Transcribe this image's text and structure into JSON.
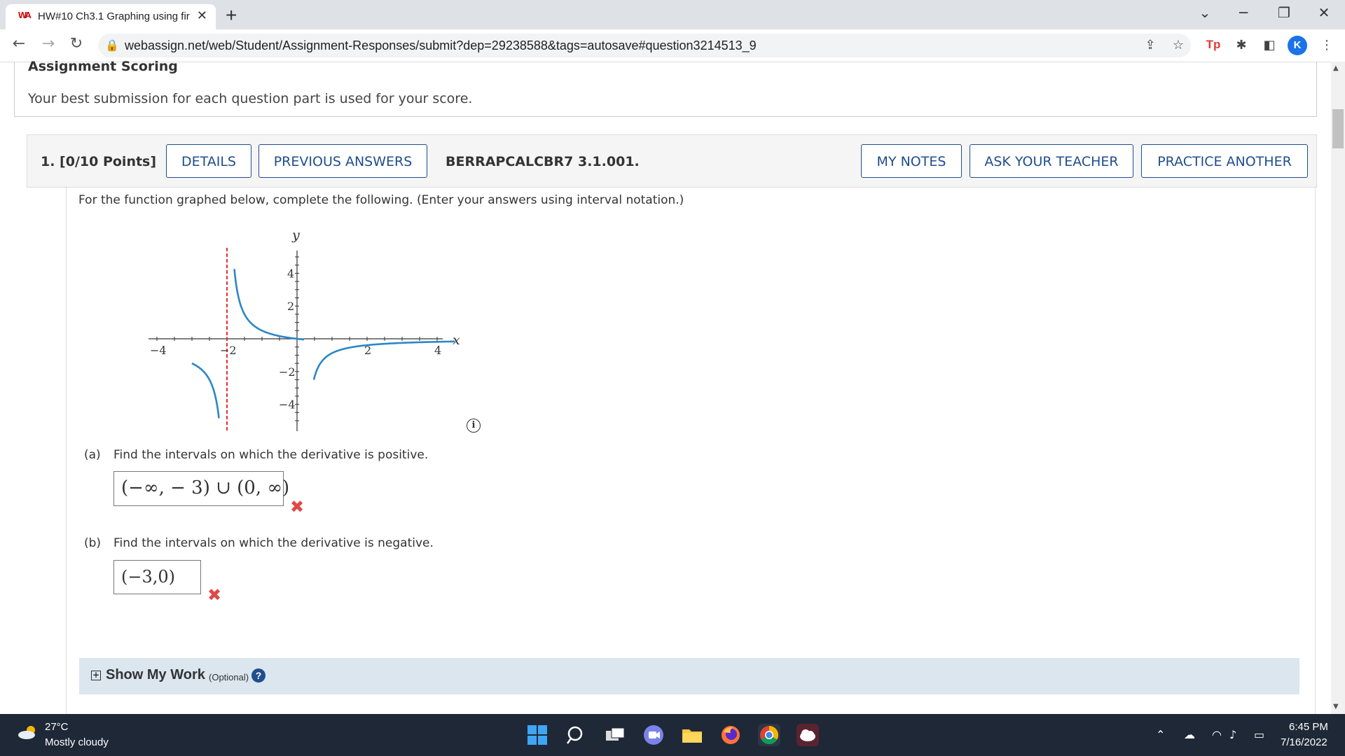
{
  "browser": {
    "tab_title": "HW#10 Ch3.1 Graphing using fir",
    "favicon_text": "WA",
    "url": "webassign.net/web/Student/Assignment-Responses/submit?dep=29238588&tags=autosave#question3214513_9",
    "profile_initial": "K",
    "extension_label": "Tp"
  },
  "scoring": {
    "title": "Assignment Scoring",
    "text": "Your best submission for each question part is used for your score."
  },
  "question": {
    "number": "1.  [0/10 Points]",
    "details_label": "DETAILS",
    "previous_answers_label": "PREVIOUS ANSWERS",
    "reference": "BERRAPCALCBR7 3.1.001.",
    "my_notes_label": "MY NOTES",
    "ask_teacher_label": "ASK YOUR TEACHER",
    "practice_another_label": "PRACTICE ANOTHER",
    "prompt": "For the function graphed below, complete the following. (Enter your answers using interval notation.)"
  },
  "graph": {
    "x_label": "x",
    "y_label": "y",
    "x_ticks": [
      "−4",
      "−2",
      "2",
      "4"
    ],
    "y_ticks": [
      "4",
      "2",
      "−2",
      "−4"
    ],
    "asymptote_x": -2,
    "curve_color": "#2b87c8",
    "asymptote_color": "#e03030"
  },
  "parts": {
    "a": {
      "label": "(a)",
      "text": "Find the intervals on which the derivative is positive.",
      "answer": "(−∞, − 3) ∪ (0, ∞)"
    },
    "b": {
      "label": "(b)",
      "text": "Find the intervals on which the derivative is negative.",
      "answer": "(−3,0)"
    }
  },
  "show_work": {
    "title": "Show My Work",
    "optional": "(Optional)",
    "help": "?"
  },
  "taskbar": {
    "temperature": "27°C",
    "condition": "Mostly cloudy",
    "time": "6:45 PM",
    "date": "7/16/2022"
  }
}
